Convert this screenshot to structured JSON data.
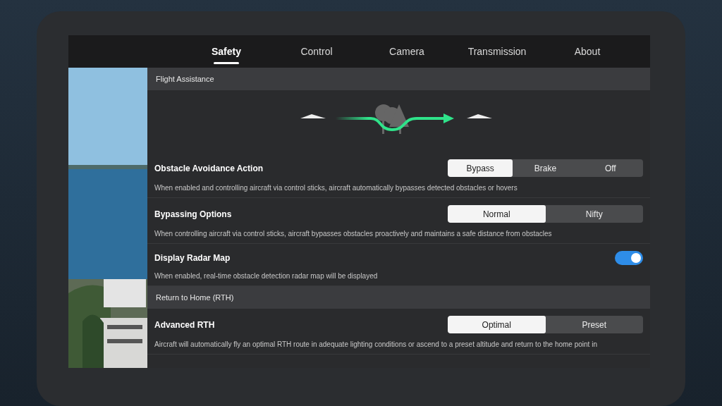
{
  "tabs": [
    {
      "label": "Safety",
      "selected": true
    },
    {
      "label": "Control",
      "selected": false
    },
    {
      "label": "Camera",
      "selected": false
    },
    {
      "label": "Transmission",
      "selected": false
    },
    {
      "label": "About",
      "selected": false
    }
  ],
  "sections": [
    {
      "kind": "illustrated",
      "title": "Flight Assistance",
      "settings": [
        {
          "kind": "segmented",
          "label": "Obstacle Avoidance Action",
          "description": "When enabled and controlling aircraft via control sticks, aircraft automatically bypasses detected obstacles or hovers",
          "options": [
            {
              "label": "Bypass",
              "selected": true
            },
            {
              "label": "Brake",
              "selected": false
            },
            {
              "label": "Off",
              "selected": false
            }
          ]
        },
        {
          "kind": "segmented",
          "label": "Bypassing Options",
          "description": "When controlling aircraft via control sticks, aircraft bypasses obstacles proactively and maintains a safe distance from obstacles",
          "options": [
            {
              "label": "Normal",
              "selected": true
            },
            {
              "label": "Nifty",
              "selected": false
            }
          ]
        },
        {
          "kind": "toggle",
          "label": "Display Radar Map",
          "description": "When enabled, real-time obstacle detection radar map will be displayed",
          "on": true
        }
      ]
    },
    {
      "kind": "plain",
      "title": "Return to Home (RTH)",
      "settings": [
        {
          "kind": "segmented",
          "label": "Advanced RTH",
          "description": "Aircraft will automatically fly an optimal RTH route in adequate lighting conditions or ascend to a preset altitude and return to the home point in",
          "options": [
            {
              "label": "Optimal",
              "selected": true
            },
            {
              "label": "Preset",
              "selected": false
            }
          ]
        }
      ]
    }
  ]
}
